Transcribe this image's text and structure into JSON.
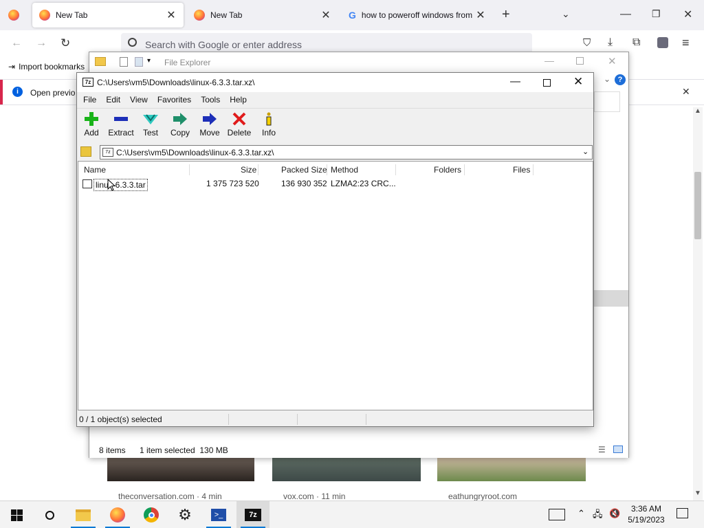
{
  "browser": {
    "tabs": [
      {
        "title": "New Tab"
      },
      {
        "title": "New Tab"
      },
      {
        "title": "how to poweroff windows from"
      }
    ],
    "search_placeholder": "Search with Google or enter address",
    "import_bookmarks": "Import bookmarks",
    "info_text": "Open previo",
    "cards": [
      {
        "source": "theconversation.com · 4 min"
      },
      {
        "source": "vox.com · 11 min"
      },
      {
        "source": "eathungryroot.com"
      }
    ]
  },
  "file_explorer": {
    "title": "File Explorer",
    "status": {
      "items": "8 items",
      "selected": "1 item selected  130 MB"
    }
  },
  "sevenzip": {
    "title": "C:\\Users\\vm5\\Downloads\\linux-6.3.3.tar.xz\\",
    "menu": [
      "File",
      "Edit",
      "View",
      "Favorites",
      "Tools",
      "Help"
    ],
    "toolbar": [
      "Add",
      "Extract",
      "Test",
      "Copy",
      "Move",
      "Delete",
      "Info"
    ],
    "path": "C:\\Users\\vm5\\Downloads\\linux-6.3.3.tar.xz\\",
    "columns": [
      "Name",
      "Size",
      "Packed Size",
      "Method",
      "Folders",
      "Files"
    ],
    "rows": [
      {
        "name": "linux-6.3.3.tar",
        "size": "1 375 723 520",
        "packed": "136 930 352",
        "method": "LZMA2:23 CRC..."
      }
    ],
    "status": "0 / 1 object(s) selected"
  },
  "taskbar": {
    "time": "3:36 AM",
    "date": "5/19/2023"
  },
  "colors": {
    "accent": "#0060df",
    "tabbar": "#f0f0f4",
    "delete_red": "#e01b1b",
    "add_green": "#19b319"
  }
}
